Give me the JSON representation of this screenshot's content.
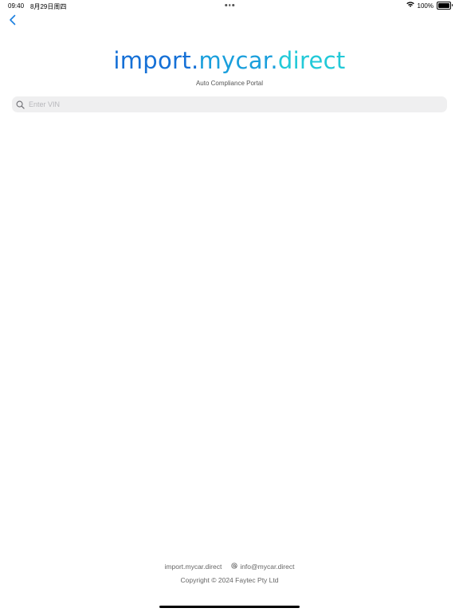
{
  "status_bar": {
    "time": "09:40",
    "date": "8月29日周四",
    "battery": "100%",
    "battery_level": 1.0,
    "icons": [
      "wifi-icon",
      "battery-icon"
    ]
  },
  "nav": {
    "back_icon": "chevron-left-icon"
  },
  "header": {
    "logo_part1": "import.",
    "logo_part2": "mycar.",
    "logo_part3": "direct",
    "subtitle": "Auto Compliance Portal"
  },
  "search": {
    "placeholder": "Enter VIN",
    "value": "",
    "icon": "search-icon"
  },
  "footer": {
    "website": "import.mycar.direct",
    "email": "info@mycar.direct",
    "email_icon": "at-icon",
    "copyright": "Copyright © 2024 Faytec Pty Ltd"
  },
  "colors": {
    "accent": "#1a7fe0",
    "logo_blue": "#1570d6",
    "logo_mid": "#1a9fdc",
    "logo_cyan": "#22c9d8",
    "search_bg": "#efeff0"
  }
}
